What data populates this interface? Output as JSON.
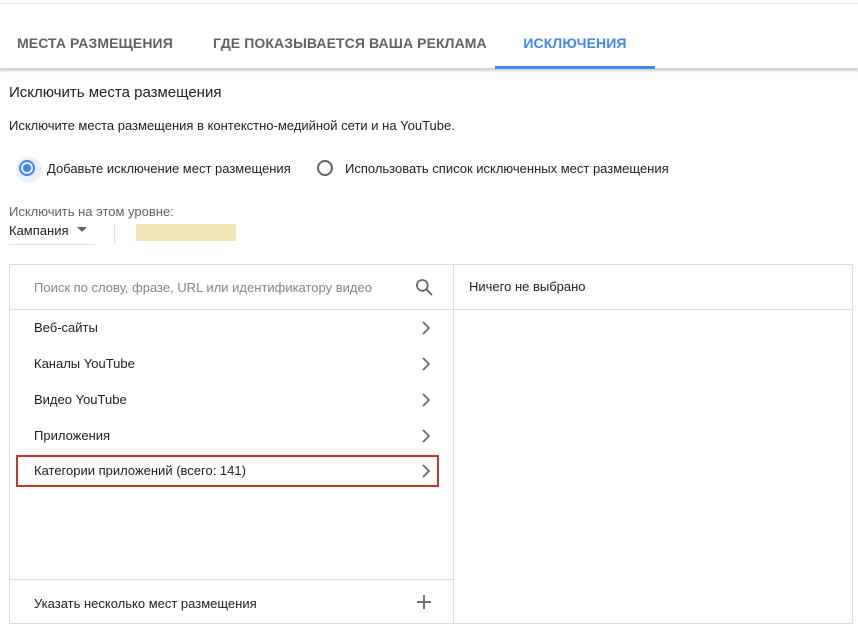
{
  "tabs": [
    {
      "label": "МЕСТА РАЗМЕЩЕНИЯ"
    },
    {
      "label": "ГДЕ ПОКАЗЫВАЕТСЯ ВАША РЕКЛАМА"
    },
    {
      "label": "ИСКЛЮЧЕНИЯ"
    }
  ],
  "accent_color": "#4285f4",
  "section": {
    "heading": "Исключить места размещения",
    "description": "Исключите места размещения в контекстно-медийной сети и на YouTube."
  },
  "radios": [
    {
      "label": "Добавьте исключение мест размещения",
      "checked": true
    },
    {
      "label": "Использовать список исключенных мест размещения",
      "checked": false
    }
  ],
  "level": {
    "label": "Исключить на этом уровне:",
    "value": "Кампания"
  },
  "browser": {
    "search_placeholder": "Поиск по слову, фразе, URL или идентификатору видео",
    "items": [
      {
        "label": "Веб-сайты"
      },
      {
        "label": "Каналы YouTube"
      },
      {
        "label": "Видео YouTube"
      },
      {
        "label": "Приложения"
      },
      {
        "label": "Категории приложений (всего: 141)"
      }
    ],
    "bulk_add_label": "Указать несколько мест размещения",
    "selected_empty_label": "Ничего не выбрано"
  }
}
